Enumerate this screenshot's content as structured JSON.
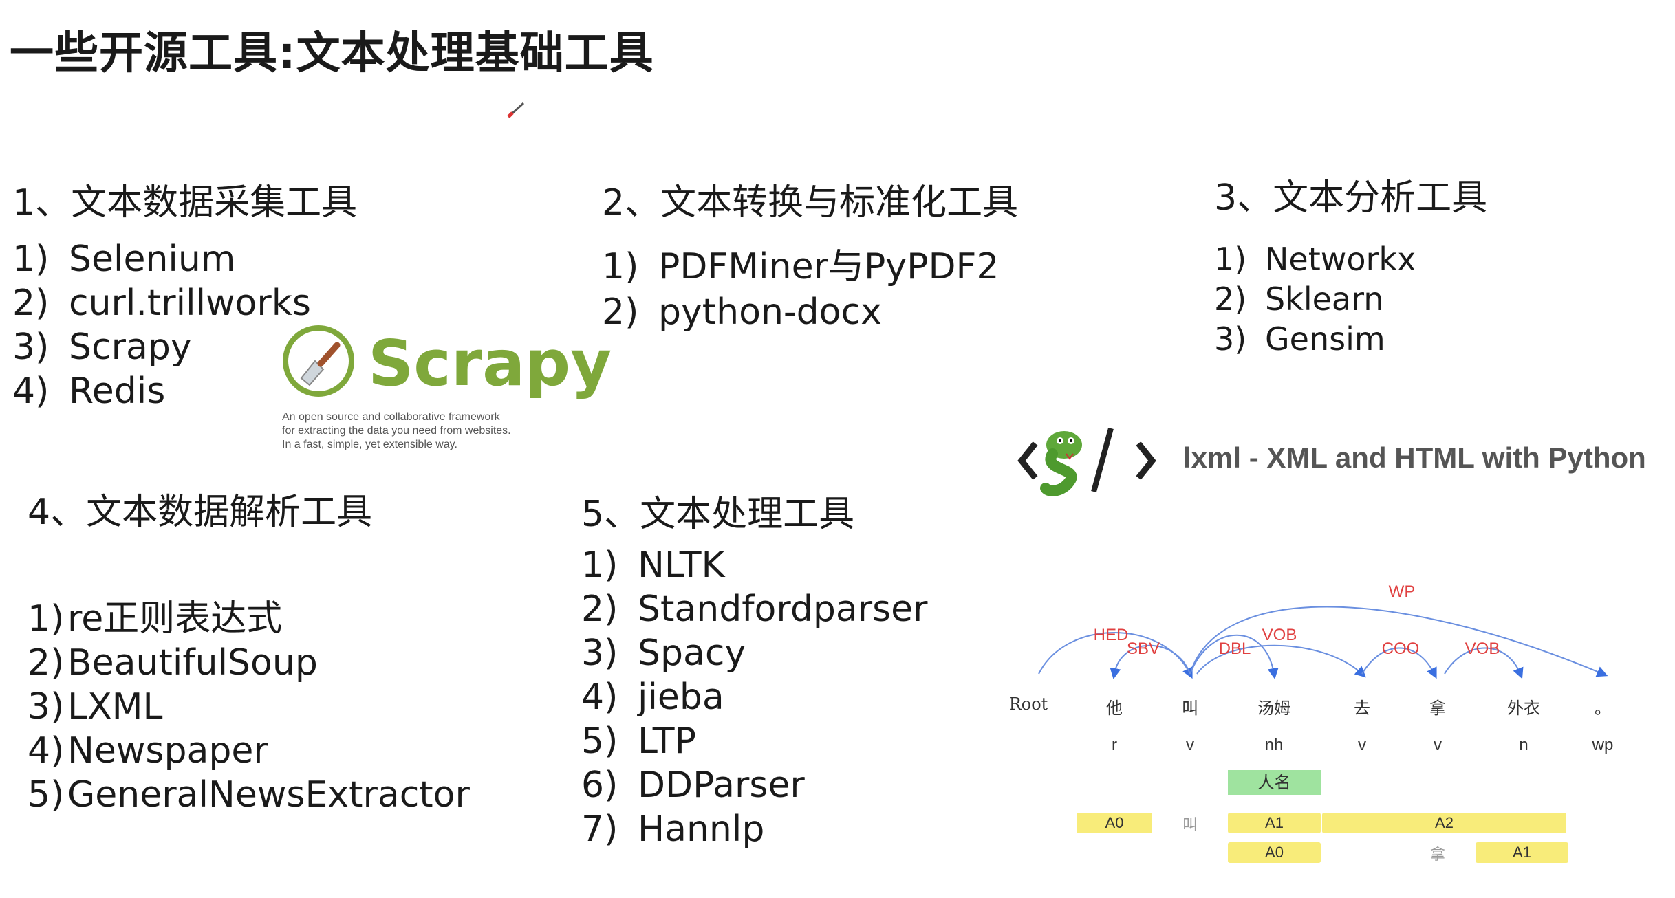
{
  "title": "一些开源工具:文本处理基础工具",
  "sections": {
    "s1": {
      "heading": "1、文本数据采集工具",
      "items": [
        {
          "num": "1)",
          "text": "Selenium"
        },
        {
          "num": "2)",
          "text": "curl.trillworks"
        },
        {
          "num": "3)",
          "text": "Scrapy"
        },
        {
          "num": "4)",
          "text": "Redis"
        }
      ]
    },
    "s2": {
      "heading": "2、文本转换与标准化工具",
      "items": [
        {
          "num": "1)",
          "text": "PDFMiner与PyPDF2"
        },
        {
          "num": "2)",
          "text": "python-docx"
        }
      ]
    },
    "s3": {
      "heading": "3、文本分析工具",
      "items": [
        {
          "num": "1)",
          "text": "Networkx"
        },
        {
          "num": "2)",
          "text": "Sklearn"
        },
        {
          "num": "3)",
          "text": "Gensim"
        }
      ]
    },
    "s4": {
      "heading": "4、文本数据解析工具",
      "items": [
        {
          "num": "1)",
          "text": "re正则表达式"
        },
        {
          "num": "2)",
          "text": "BeautifulSoup"
        },
        {
          "num": "3)",
          "text": "LXML"
        },
        {
          "num": "4)",
          "text": "Newspaper"
        },
        {
          "num": "5)",
          "text": "GeneralNewsExtractor"
        }
      ]
    },
    "s5": {
      "heading": "5、文本处理工具",
      "items": [
        {
          "num": "1)",
          "text": "NLTK"
        },
        {
          "num": "2)",
          "text": "Standfordparser"
        },
        {
          "num": "3)",
          "text": "Spacy"
        },
        {
          "num": "4)",
          "text": "jieba"
        },
        {
          "num": "5)",
          "text": "LTP"
        },
        {
          "num": "6)",
          "text": "DDParser"
        },
        {
          "num": "7)",
          "text": "Hannlp"
        }
      ]
    }
  },
  "scrapy_logo": {
    "name": "Scrapy",
    "tagline": [
      "An open source and collaborative framework",
      "for extracting the data you need from websites.",
      "In a fast, simple, yet extensible way."
    ],
    "color": "#7fa83b"
  },
  "lxml_logo": {
    "text": "lxml - XML and HTML with Python"
  },
  "parse": {
    "tokens": [
      "Root",
      "他",
      "叫",
      "汤姆",
      "去",
      "拿",
      "外衣",
      "。"
    ],
    "pos": [
      "",
      "r",
      "v",
      "nh",
      "v",
      "v",
      "n",
      "wp"
    ],
    "arcs": [
      "WP",
      "HED",
      "SBV",
      "VOB",
      "DBL",
      "COO",
      "VOB"
    ],
    "ner": "人名",
    "srl_row1": [
      "A0",
      "叫",
      "A1",
      "A2"
    ],
    "srl_row2": [
      "A0",
      "拿",
      "A1"
    ],
    "arc_color": "#e04040",
    "line_color": "#6a8fe0"
  }
}
